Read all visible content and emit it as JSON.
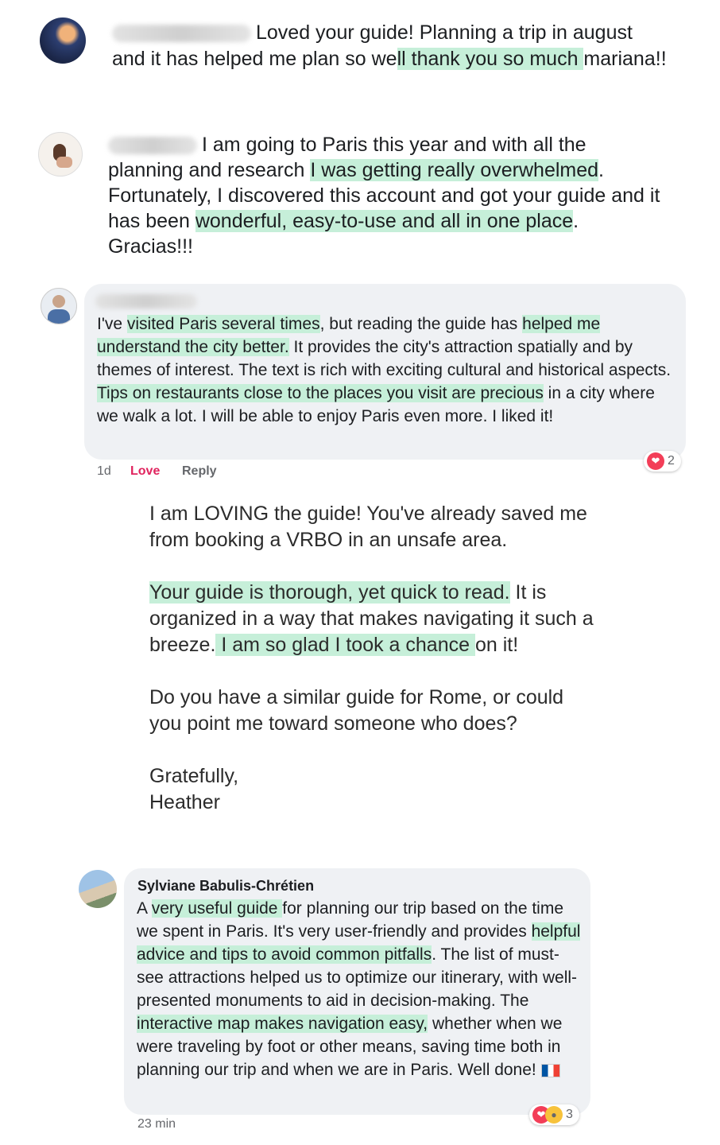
{
  "comments": [
    {
      "segments": [
        {
          "text": "Loved your guide! Planning a trip in august and it has helped me plan so we"
        },
        {
          "text": "ll thank you so much ",
          "hl": true
        },
        {
          "text": "mariana!!"
        }
      ]
    },
    {
      "segments": [
        {
          "text": "I am going to Paris this year and with all the planning and research "
        },
        {
          "text": "I was getting really overwhelmed",
          "hl": true
        },
        {
          "text": ". Fortunately, I discovered this account and got your guide and it has been "
        },
        {
          "text": "wonderful, easy-to-use and all in one place",
          "hl": true
        },
        {
          "text": ". Gracias!!!"
        }
      ]
    },
    {
      "segments": [
        {
          "text": "I've "
        },
        {
          "text": "visited Paris several times",
          "hl": true
        },
        {
          "text": ", but reading the guide has "
        },
        {
          "text": "helped me understand the city better.",
          "hl": true
        },
        {
          "text": " It provides the city's attraction spatially and by themes of interest. The text is rich with exciting cultural and historical aspects. "
        },
        {
          "text": "Tips on restaurants close to the places you visit are precious",
          "hl": true
        },
        {
          "text": " in a city where we walk a lot. I will be able to enjoy Paris even more. I liked it!"
        }
      ],
      "time": "1d",
      "love_label": "Love",
      "reply_label": "Reply",
      "reaction_count": "2"
    },
    {
      "name": "Sylviane Babulis-Chrétien",
      "segments": [
        {
          "text": "A "
        },
        {
          "text": "very useful guide ",
          "hl": true
        },
        {
          "text": "for planning our trip based on the time we spent in Paris. It's very user-friendly and provides "
        },
        {
          "text": "helpful advice and tips to avoid common pitfalls",
          "hl": true
        },
        {
          "text": ". The list of must-see attractions helped us to optimize our itinerary, with well-presented monuments to aid in decision-making. The "
        },
        {
          "text": "interactive map makes navigation easy,",
          "hl": true
        },
        {
          "text": " whether when we were traveling by foot or other means, saving time both in planning our trip and when we are in Paris. Well done! "
        }
      ],
      "time": "23 min",
      "reaction_count": "3"
    }
  ],
  "email": {
    "paragraphs": [
      [
        {
          "text": "I am LOVING the guide! You've already saved me from booking a VRBO in an unsafe area."
        }
      ],
      [
        {
          "text": "Your guide is thorough, yet quick to read.",
          "hl": true
        },
        {
          "text": " It is organized in a way that makes navigating it such a breeze."
        },
        {
          "text": " I am so glad I took a chance ",
          "hl": true
        },
        {
          "text": "on it!"
        }
      ],
      [
        {
          "text": "Do you have a similar guide for Rome, or could you point me toward someone who does?"
        }
      ]
    ],
    "signoff": "Gratefully,",
    "signature": "Heather"
  },
  "icons": {
    "heart": "heart-icon",
    "wow": "wow-icon",
    "flag": "france-flag-icon"
  },
  "colors": {
    "highlight": "#c6efd9",
    "bubble": "#eff1f4",
    "love": "#e0245e"
  }
}
